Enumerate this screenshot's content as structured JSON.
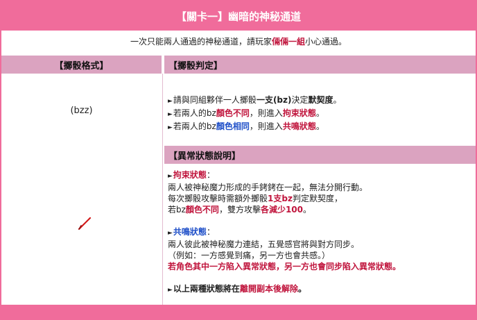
{
  "title": "【關卡一】幽暗的神秘通道",
  "intro": {
    "before": "一次只能兩人通過的神秘通道，請玩家",
    "highlight": "倆倆一組",
    "after": "小心通過。"
  },
  "headers": {
    "format": "【擲骰格式】",
    "judge": "【擲骰判定】",
    "status": "【異常狀態說明】"
  },
  "format_value": "(bzz)",
  "icons": {
    "bullet": "triangle-right",
    "pencil": "pencil-icon"
  },
  "colors": {
    "title_bg": "#f06c9b",
    "header_bg": "#dba3c0",
    "red": "#c0143c",
    "blue": "#1f4fc8"
  },
  "rules": {
    "r1_a": "請與同組夥伴一人擲骰",
    "r1_b": "一支(bz)",
    "r1_c": "決定",
    "r1_d": "默契度",
    "r1_e": "。",
    "r2_a": "若兩人的bz",
    "r2_b": "顏色不同",
    "r2_c": "，則進入",
    "r2_d": "拘束狀態",
    "r2_e": "。",
    "r3_a": "若兩人的bz",
    "r3_b": "顏色相同",
    "r3_c": "，則進入",
    "r3_d": "共鳴狀態",
    "r3_e": "。"
  },
  "bind_state": {
    "name": "拘束狀態",
    "colon": "：",
    "l1": "兩人被神秘魔力形成的手銬銬在一起，無法分開行動。",
    "l2_a": "每次擲骰攻擊時需額外擲骰",
    "l2_b": "1支bz",
    "l2_c": "判定默契度，",
    "l3_a": "若bz",
    "l3_b": "顏色不同",
    "l3_c": "，雙方攻擊",
    "l3_d": "各減少100",
    "l3_e": "。"
  },
  "resonance_state": {
    "name": "共鳴狀態",
    "colon": "：",
    "l1": "兩人彼此被神秘魔力連結，五覺感官將與對方同步。",
    "l2": "（例如：一方感覺到痛，另一方也會共感。）",
    "l3": "若角色其中一方陷入異常狀態，另一方也會同步陷入異常狀態。"
  },
  "note": {
    "a": "以上兩種狀態將在",
    "b": "離開副本後解除",
    "c": "。"
  }
}
